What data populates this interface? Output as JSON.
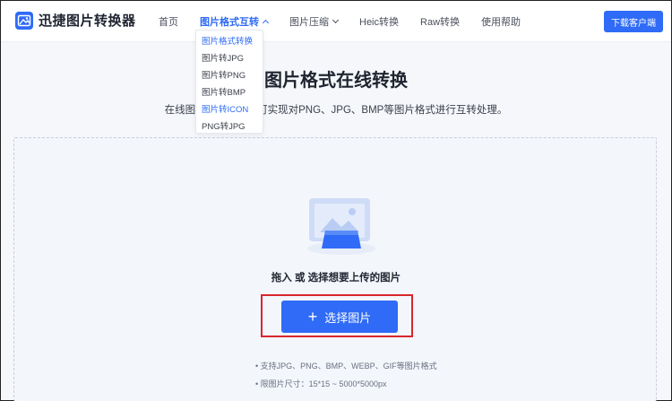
{
  "header": {
    "logo_text": "迅捷图片转换器",
    "download_label": "下载客户端"
  },
  "nav": {
    "items": [
      {
        "label": "首页"
      },
      {
        "label": "图片格式互转"
      },
      {
        "label": "图片压缩"
      },
      {
        "label": "Heic转换"
      },
      {
        "label": "Raw转换"
      },
      {
        "label": "使用帮助"
      }
    ]
  },
  "dropdown": {
    "items": [
      {
        "label": "图片格式转换"
      },
      {
        "label": "图片转JPG"
      },
      {
        "label": "图片转PNG"
      },
      {
        "label": "图片转BMP"
      },
      {
        "label": "图片转ICON"
      },
      {
        "label": "PNG转JPG"
      }
    ]
  },
  "main": {
    "title": "图片格式在线转换",
    "subtitle": "在线图片格式转换，可实现对PNG、JPG、BMP等图片格式进行互转处理。",
    "drop_text": "拖入 或 选择想要上传的图片",
    "choose_label": "选择图片",
    "note_formats": "• 支持JPG、PNG、BMP、WEBP、GIF等图片格式",
    "note_size": "• 限图片尺寸：15*15 ~ 5000*5000px"
  },
  "colors": {
    "accent": "#2f6bf6",
    "highlight": "#d8262c"
  }
}
